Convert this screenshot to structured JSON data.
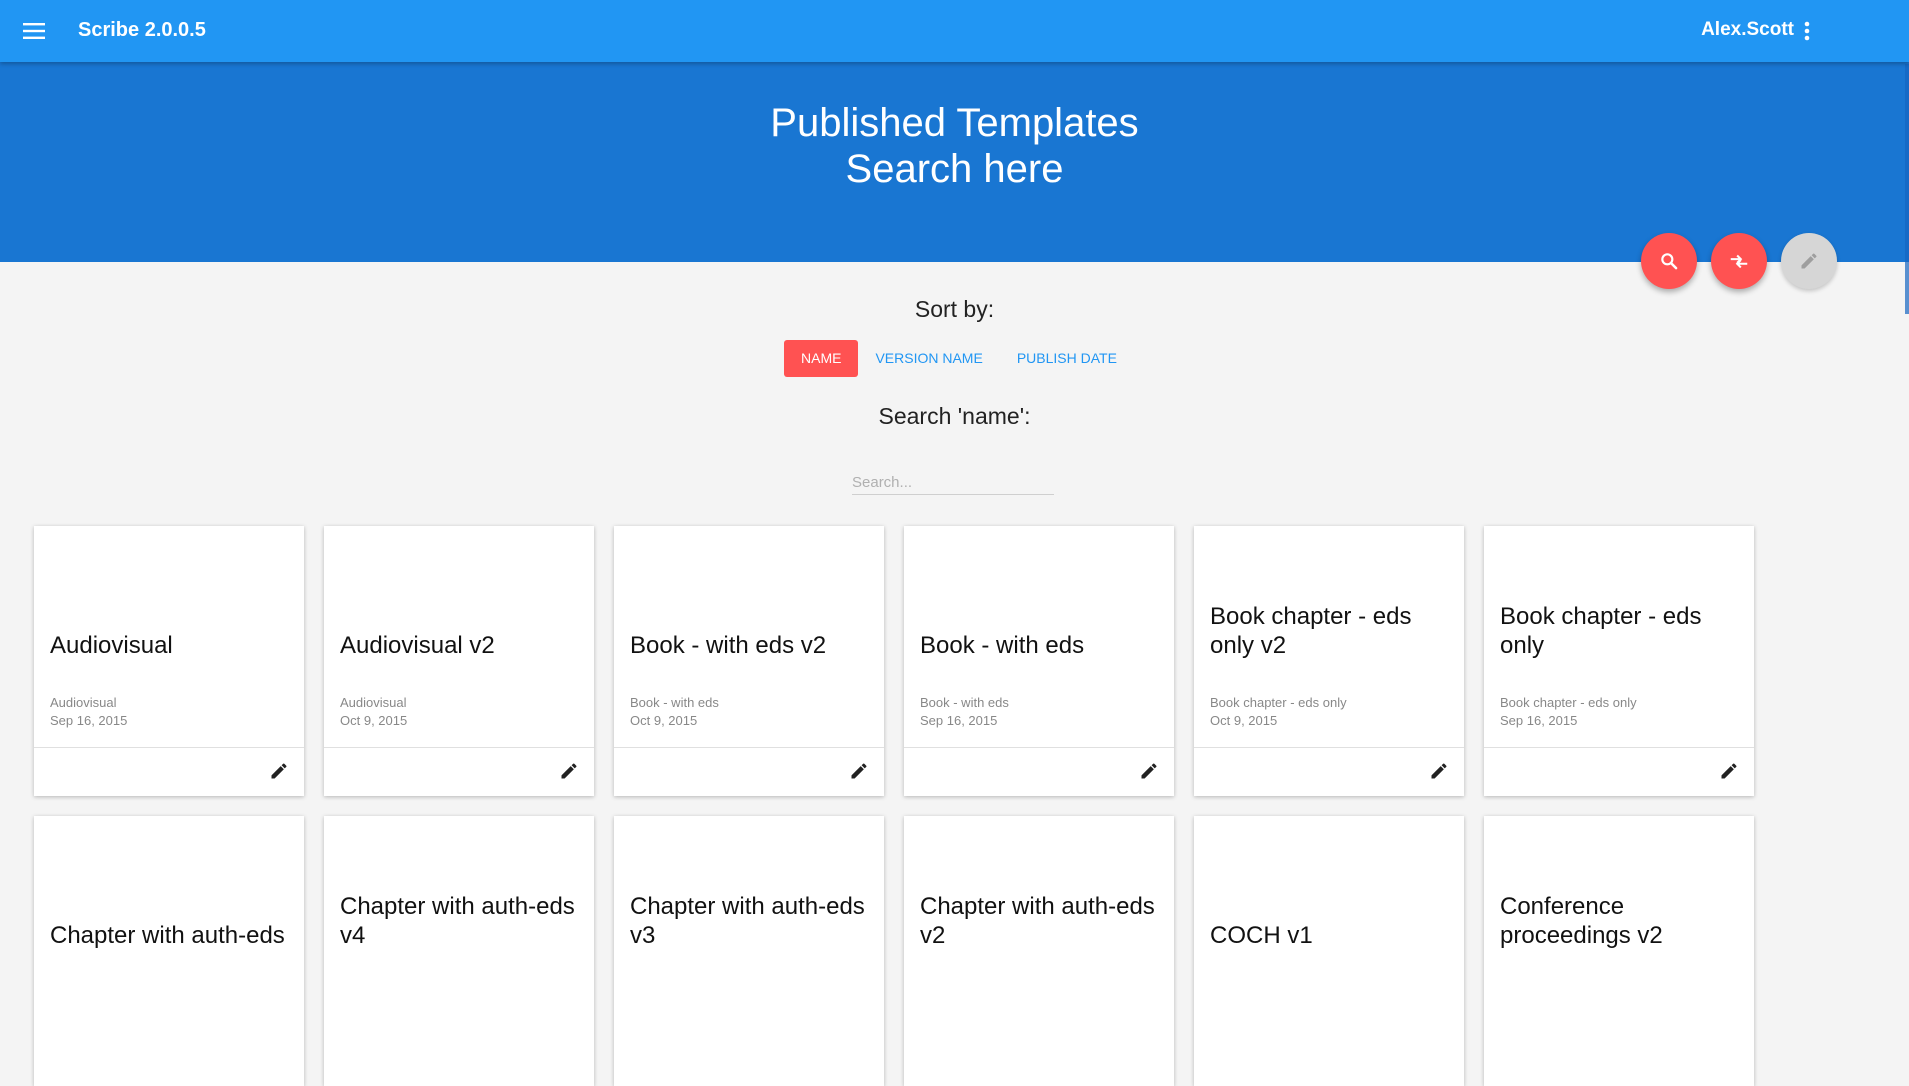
{
  "app": {
    "title": "Scribe 2.0.0.5",
    "user": "Alex.Scott"
  },
  "hero": {
    "line1": "Published Templates",
    "line2": "Search here"
  },
  "icons": {
    "menu": "menu-icon",
    "more": "more-vert-icon",
    "search": "search-icon",
    "compare": "compare-arrows-icon",
    "edit": "pencil-icon"
  },
  "colors": {
    "appbar": "#2196f3",
    "hero": "#1976d2",
    "accent": "#ff5252",
    "link": "#2196f3"
  },
  "sort": {
    "label": "Sort by:",
    "options": [
      "NAME",
      "VERSION NAME",
      "PUBLISH DATE"
    ],
    "active": "NAME"
  },
  "search": {
    "label": "Search 'name':",
    "placeholder": "Search...",
    "value": ""
  },
  "cards": [
    {
      "title": "Audiovisual",
      "subtitle": "Audiovisual",
      "date": "Sep 16, 2015"
    },
    {
      "title": "Audiovisual v2",
      "subtitle": "Audiovisual",
      "date": "Oct 9, 2015"
    },
    {
      "title": "Book - with eds v2",
      "subtitle": "Book - with eds",
      "date": "Oct 9, 2015"
    },
    {
      "title": "Book - with eds",
      "subtitle": "Book - with eds",
      "date": "Sep 16, 2015"
    },
    {
      "title": "Book chapter - eds only v2",
      "subtitle": "Book chapter - eds only",
      "date": "Oct 9, 2015"
    },
    {
      "title": "Book chapter - eds only",
      "subtitle": "Book chapter - eds only",
      "date": "Sep 16, 2015"
    },
    {
      "title": "Chapter with auth-eds",
      "subtitle": "",
      "date": ""
    },
    {
      "title": "Chapter with auth-eds v4",
      "subtitle": "",
      "date": ""
    },
    {
      "title": "Chapter with auth-eds v3",
      "subtitle": "",
      "date": ""
    },
    {
      "title": "Chapter with auth-eds v2",
      "subtitle": "",
      "date": ""
    },
    {
      "title": "COCH v1",
      "subtitle": "",
      "date": ""
    },
    {
      "title": "Conference proceedings v2",
      "subtitle": "",
      "date": ""
    }
  ]
}
